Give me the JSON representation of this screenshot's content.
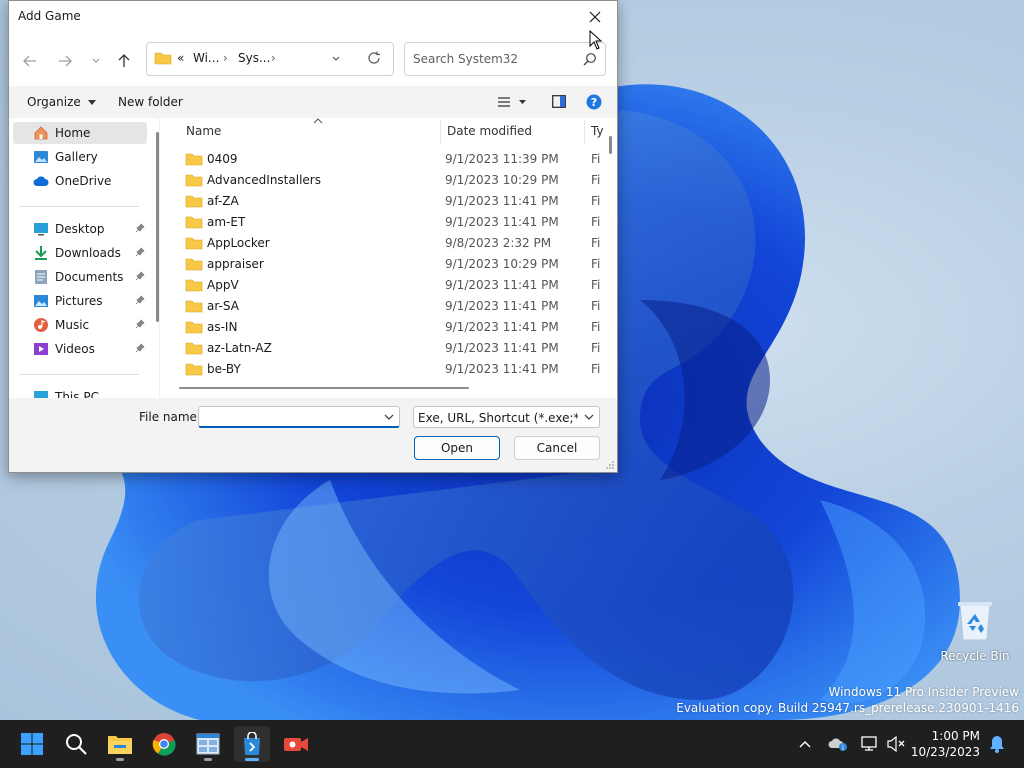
{
  "dialog": {
    "title": "Add Game",
    "address": {
      "overflow": "«",
      "seg1": "Wi...",
      "seg2": "Sys..."
    },
    "search_placeholder": "Search System32",
    "toolbar": {
      "organize": "Organize",
      "new_folder": "New folder"
    },
    "nav": {
      "items": [
        {
          "label": "Home",
          "icon": "home-icon",
          "selected": true
        },
        {
          "label": "Gallery",
          "icon": "gallery-icon"
        },
        {
          "label": "OneDrive",
          "icon": "onedrive-icon"
        },
        {
          "label": "Desktop",
          "icon": "desktop-icon",
          "pinned": true
        },
        {
          "label": "Downloads",
          "icon": "downloads-icon",
          "pinned": true
        },
        {
          "label": "Documents",
          "icon": "documents-icon",
          "pinned": true
        },
        {
          "label": "Pictures",
          "icon": "pictures-icon",
          "pinned": true
        },
        {
          "label": "Music",
          "icon": "music-icon",
          "pinned": true
        },
        {
          "label": "Videos",
          "icon": "videos-icon",
          "pinned": true
        },
        {
          "label": "This PC",
          "icon": "this-pc-icon"
        }
      ]
    },
    "columns": {
      "name": "Name",
      "date": "Date modified",
      "type": "Ty"
    },
    "files": [
      {
        "name": "0409",
        "date": "9/1/2023 11:39 PM",
        "type": "Fi"
      },
      {
        "name": "AdvancedInstallers",
        "date": "9/1/2023 10:29 PM",
        "type": "Fi"
      },
      {
        "name": "af-ZA",
        "date": "9/1/2023 11:41 PM",
        "type": "Fi"
      },
      {
        "name": "am-ET",
        "date": "9/1/2023 11:41 PM",
        "type": "Fi"
      },
      {
        "name": "AppLocker",
        "date": "9/8/2023 2:32 PM",
        "type": "Fi"
      },
      {
        "name": "appraiser",
        "date": "9/1/2023 10:29 PM",
        "type": "Fi"
      },
      {
        "name": "AppV",
        "date": "9/1/2023 11:41 PM",
        "type": "Fi"
      },
      {
        "name": "ar-SA",
        "date": "9/1/2023 11:41 PM",
        "type": "Fi"
      },
      {
        "name": "as-IN",
        "date": "9/1/2023 11:41 PM",
        "type": "Fi"
      },
      {
        "name": "az-Latn-AZ",
        "date": "9/1/2023 11:41 PM",
        "type": "Fi"
      },
      {
        "name": "be-BY",
        "date": "9/1/2023 11:41 PM",
        "type": "Fi"
      }
    ],
    "file_name_label": "File name:",
    "file_name_value": "",
    "filter": "Exe, URL, Shortcut (*.exe;*.url;*.",
    "open_label": "Open",
    "cancel_label": "Cancel"
  },
  "desktop": {
    "recycle_bin": "Recycle Bin",
    "watermark_line1": "Windows 11 Pro Insider Preview",
    "watermark_line2": "Evaluation copy. Build 25947.rs_prerelease.230901-1416"
  },
  "taskbar": {
    "apps": [
      "start-icon",
      "search-icon",
      "file-explorer-icon",
      "chrome-icon",
      "app-window-icon",
      "game-store-icon",
      "camera-app-icon"
    ],
    "time": "1:00 PM",
    "date": "10/23/2023"
  },
  "colors": {
    "accent": "#005fb8",
    "folder": "#f8c847",
    "taskbar": "#1f1f1f"
  }
}
